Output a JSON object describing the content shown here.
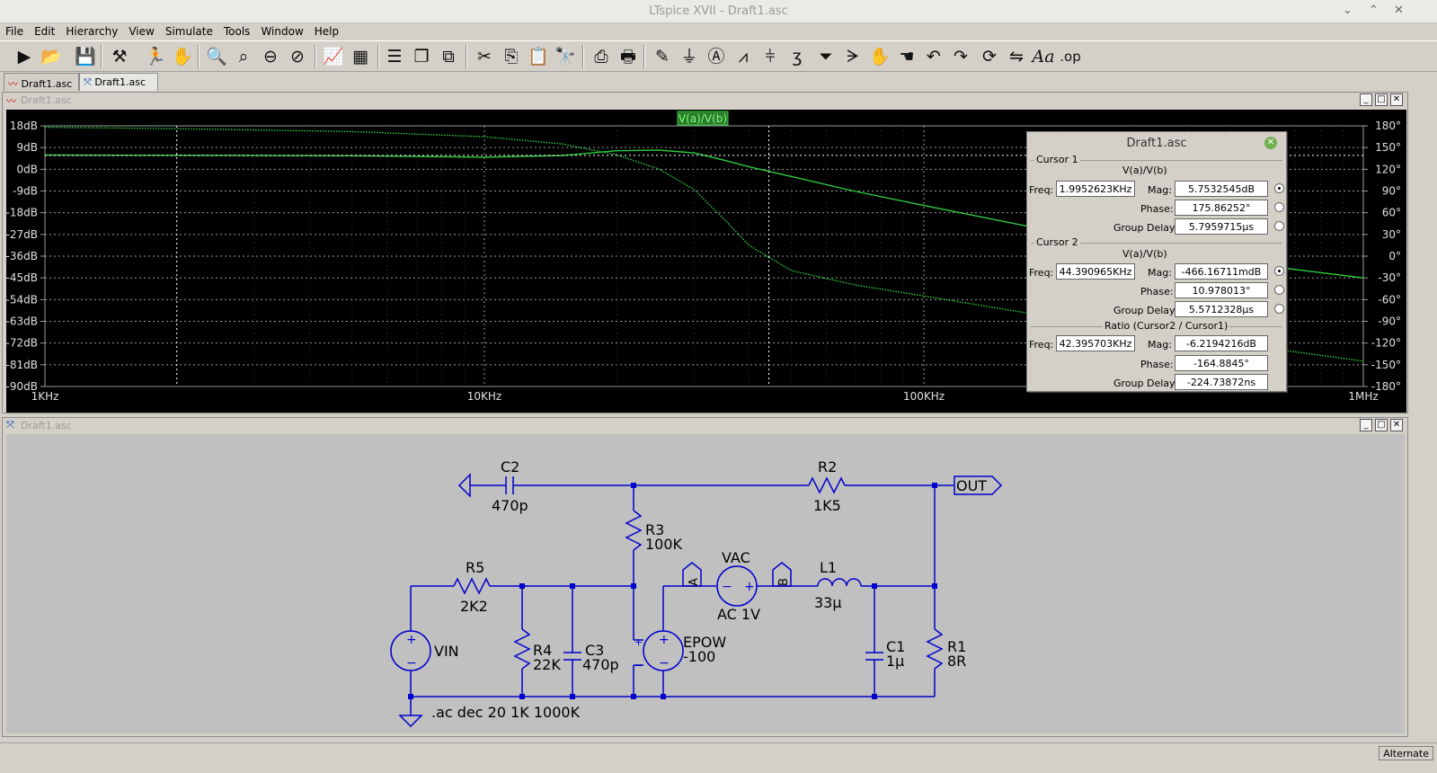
{
  "window": {
    "title": "LTspice XVII - Draft1.asc"
  },
  "menu": [
    "File",
    "Edit",
    "Hierarchy",
    "View",
    "Simulate",
    "Tools",
    "Window",
    "Help"
  ],
  "toolbar": {
    "groups": [
      [
        "run-icon",
        "open-icon",
        "save-icon"
      ],
      [
        "control-panel-icon",
        "halt-icon",
        "hand-pan-icon"
      ],
      [
        "zoom-in-icon",
        "zoom-pan-icon",
        "zoom-out-icon",
        "zoom-fit-icon"
      ],
      [
        "autoscale-icon",
        "delete-trace-icon"
      ],
      [
        "tile-horizontal-icon",
        "cascade-icon",
        "tile-vertical-icon"
      ],
      [
        "cut-icon",
        "copy-icon",
        "paste-icon",
        "find-icon"
      ],
      [
        "print-icon",
        "print-setup-icon"
      ],
      [
        "wire-icon",
        "ground-icon",
        "label-icon",
        "resistor-icon",
        "capacitor-icon",
        "inductor-icon",
        "diode-icon",
        "component-icon",
        "move-icon",
        "drag-icon",
        "undo-icon",
        "redo-icon",
        "rotate-icon",
        "mirror-icon",
        "text-icon",
        "spice-directive-icon"
      ]
    ],
    "text_tool": "Aa",
    "op_tool": ".op"
  },
  "tabs": [
    {
      "label": "Draft1.asc",
      "icon": "waveform-icon",
      "active": false
    },
    {
      "label": "Draft1.asc",
      "icon": "schematic-icon",
      "active": true
    }
  ],
  "plot_window": {
    "title": "Draft1.asc",
    "controls": {
      "minimize": "_",
      "restore": "□",
      "close": "✕"
    },
    "trace_label": "V(a)/V(b)",
    "left_axis": [
      "18dB",
      "9dB",
      "0dB",
      "-9dB",
      "-18dB",
      "-27dB",
      "-36dB",
      "-45dB",
      "-54dB",
      "-63dB",
      "-72dB",
      "-81dB",
      "-90dB"
    ],
    "right_axis": [
      "180°",
      "150°",
      "120°",
      "90°",
      "60°",
      "30°",
      "0°",
      "-30°",
      "-60°",
      "-90°",
      "-120°",
      "-150°",
      "-180°"
    ],
    "x_axis": [
      "1KHz",
      "10KHz",
      "100KHz",
      "1MHz"
    ],
    "colors": {
      "background": "#000000",
      "trace": "#2ecc40",
      "grid": "#9a9a9a",
      "label_bg": "#2a7a2a"
    }
  },
  "chart_data": {
    "type": "line",
    "title": "V(a)/V(b)",
    "x_scale": "log",
    "xlim": [
      1000,
      1000000
    ],
    "x_ticks": [
      "1KHz",
      "10KHz",
      "100KHz",
      "1MHz"
    ],
    "y_left": {
      "ylim": [
        -90,
        18
      ],
      "unit": "dB",
      "ticks": [
        18,
        9,
        0,
        -9,
        -18,
        -27,
        -36,
        -45,
        -54,
        -63,
        -72,
        -81,
        -90
      ]
    },
    "y_right": {
      "ylim": [
        -180,
        180
      ],
      "unit": "°",
      "ticks": [
        180,
        150,
        120,
        90,
        60,
        30,
        0,
        -30,
        -60,
        -90,
        -120,
        -150,
        -180
      ]
    },
    "grid": true,
    "series": [
      {
        "axis": "left",
        "style": "solid",
        "x": [
          1000,
          2000,
          5000,
          10000,
          15000,
          20000,
          25000,
          30000,
          35000,
          40000,
          50000,
          70000,
          100000,
          200000,
          500000,
          1000000
        ],
        "y": [
          5.9,
          5.8,
          5.6,
          5.0,
          5.7,
          7.7,
          7.9,
          6.8,
          3.8,
          1.0,
          -3.0,
          -9.2,
          -15.0,
          -26.0,
          -38.2,
          -45.0
        ]
      },
      {
        "axis": "right",
        "style": "dotted",
        "x": [
          1000,
          2000,
          5000,
          10000,
          15000,
          20000,
          25000,
          30000,
          35000,
          40000,
          50000,
          70000,
          100000,
          200000,
          500000,
          1000000
        ],
        "y": [
          178,
          176,
          172,
          165,
          155,
          140,
          120,
          92,
          52,
          15,
          -20,
          -40,
          -55,
          -85,
          -120,
          -145
        ]
      }
    ]
  },
  "cursor_dialog": {
    "title": "Draft1.asc",
    "cursor1": {
      "group": "Cursor 1",
      "trace": "V(a)/V(b)",
      "freq_label": "Freq:",
      "freq": "1.9952623KHz",
      "mag_label": "Mag:",
      "mag": "5.7532545dB",
      "phase_label": "Phase:",
      "phase": "175.86252°",
      "gd_label": "Group Delay:",
      "gd": "5.7959715µs"
    },
    "cursor2": {
      "group": "Cursor 2",
      "trace": "V(a)/V(b)",
      "freq_label": "Freq:",
      "freq": "44.390965KHz",
      "mag_label": "Mag:",
      "mag": "-466.16711mdB",
      "phase_label": "Phase:",
      "phase": "10.978013°",
      "gd_label": "Group Delay:",
      "gd": "5.5712328µs"
    },
    "ratio": {
      "group": "Ratio (Cursor2 / Cursor1)",
      "freq_label": "Freq:",
      "freq": "42.395703KHz",
      "mag_label": "Mag:",
      "mag": "-6.2194216dB",
      "phase_label": "Phase:",
      "phase": "-164.8845°",
      "gd_label": "Group Delay:",
      "gd": "-224.73872ns"
    }
  },
  "schematic_window": {
    "title": "Draft1.asc",
    "colors": {
      "background": "#c0c0c0",
      "wire": "#0000cc",
      "component": "#0000cc",
      "text": "#000000"
    },
    "components": {
      "c2": {
        "name": "C2",
        "value": "470p"
      },
      "r2": {
        "name": "R2",
        "value": "1K5"
      },
      "r3": {
        "name": "R3",
        "value": "100K"
      },
      "r5": {
        "name": "R5",
        "value": "2K2"
      },
      "r4": {
        "name": "R4",
        "value": "22K"
      },
      "c3": {
        "name": "C3",
        "value": "470p"
      },
      "vac": {
        "name": "VAC",
        "value": "AC 1V"
      },
      "l1": {
        "name": "L1",
        "value": "33µ"
      },
      "c1": {
        "name": "C1",
        "value": "1µ"
      },
      "r1": {
        "name": "R1",
        "value": "8R"
      },
      "vin": {
        "name": "VIN"
      },
      "epow": {
        "name": "EPOW",
        "value": "-100"
      }
    },
    "labels": {
      "out": "OUT",
      "a": "A",
      "b": "B"
    },
    "directive": ".ac dec 20 1K 1000K"
  },
  "status": {
    "mode": "Alternate"
  }
}
